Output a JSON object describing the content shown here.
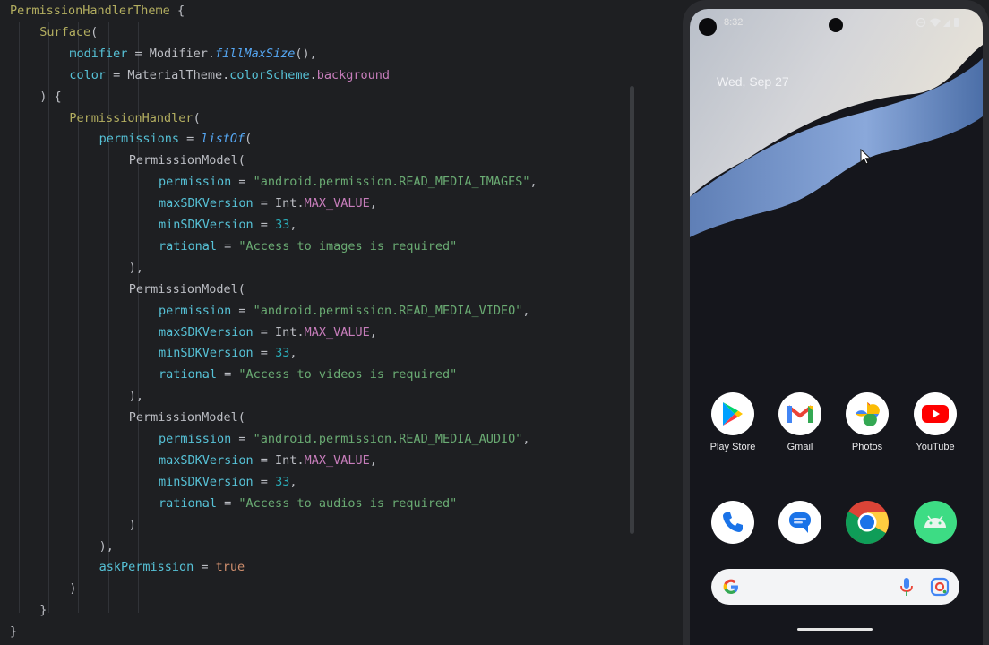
{
  "editor": {
    "lines": [
      {
        "indent": 0,
        "tokens": [
          [
            "PermissionHandlerTheme",
            "t-call"
          ],
          [
            " {",
            "t-plain"
          ]
        ]
      },
      {
        "indent": 1,
        "tokens": [
          [
            "Surface",
            "t-call"
          ],
          [
            "(",
            "t-plain"
          ]
        ]
      },
      {
        "indent": 2,
        "tokens": [
          [
            "modifier",
            "t-param"
          ],
          [
            " = Modifier.",
            "t-plain"
          ],
          [
            "fillMaxSize",
            "t-fn"
          ],
          [
            "(),",
            "t-plain"
          ]
        ]
      },
      {
        "indent": 2,
        "tokens": [
          [
            "color",
            "t-param"
          ],
          [
            " = MaterialTheme.",
            "t-plain"
          ],
          [
            "colorScheme",
            "t-param"
          ],
          [
            ".",
            "t-plain"
          ],
          [
            "background",
            "t-const"
          ]
        ]
      },
      {
        "indent": 1,
        "tokens": [
          [
            ") {",
            "t-plain"
          ]
        ]
      },
      {
        "indent": 2,
        "tokens": [
          [
            "PermissionHandler",
            "t-call"
          ],
          [
            "(",
            "t-plain"
          ]
        ]
      },
      {
        "indent": 3,
        "tokens": [
          [
            "permissions",
            "t-param"
          ],
          [
            " = ",
            "t-plain"
          ],
          [
            "listOf",
            "t-fn"
          ],
          [
            "(",
            "t-plain"
          ]
        ]
      },
      {
        "indent": 4,
        "tokens": [
          [
            "PermissionModel(",
            "t-plain"
          ]
        ]
      },
      {
        "indent": 5,
        "tokens": [
          [
            "permission",
            "t-param"
          ],
          [
            " = ",
            "t-plain"
          ],
          [
            "\"android.permission.READ_MEDIA_IMAGES\"",
            "t-str"
          ],
          [
            ",",
            "t-plain"
          ]
        ]
      },
      {
        "indent": 5,
        "tokens": [
          [
            "maxSDKVersion",
            "t-param"
          ],
          [
            " = Int.",
            "t-plain"
          ],
          [
            "MAX_VALUE",
            "t-const"
          ],
          [
            ",",
            "t-plain"
          ]
        ]
      },
      {
        "indent": 5,
        "tokens": [
          [
            "minSDKVersion",
            "t-param"
          ],
          [
            " = ",
            "t-plain"
          ],
          [
            "33",
            "t-num"
          ],
          [
            ",",
            "t-plain"
          ]
        ]
      },
      {
        "indent": 5,
        "tokens": [
          [
            "rational",
            "t-param"
          ],
          [
            " = ",
            "t-plain"
          ],
          [
            "\"Access to images is required\"",
            "t-str"
          ]
        ]
      },
      {
        "indent": 4,
        "tokens": [
          [
            "),",
            "t-plain"
          ]
        ]
      },
      {
        "indent": 4,
        "tokens": [
          [
            "PermissionModel(",
            "t-plain"
          ]
        ]
      },
      {
        "indent": 5,
        "tokens": [
          [
            "permission",
            "t-param"
          ],
          [
            " = ",
            "t-plain"
          ],
          [
            "\"android.permission.READ_MEDIA_VIDEO\"",
            "t-str"
          ],
          [
            ",",
            "t-plain"
          ]
        ]
      },
      {
        "indent": 5,
        "tokens": [
          [
            "maxSDKVersion",
            "t-param"
          ],
          [
            " = Int.",
            "t-plain"
          ],
          [
            "MAX_VALUE",
            "t-const"
          ],
          [
            ",",
            "t-plain"
          ]
        ]
      },
      {
        "indent": 5,
        "tokens": [
          [
            "minSDKVersion",
            "t-param"
          ],
          [
            " = ",
            "t-plain"
          ],
          [
            "33",
            "t-num"
          ],
          [
            ",",
            "t-plain"
          ]
        ]
      },
      {
        "indent": 5,
        "tokens": [
          [
            "rational",
            "t-param"
          ],
          [
            " = ",
            "t-plain"
          ],
          [
            "\"Access to videos is required\"",
            "t-str"
          ]
        ]
      },
      {
        "indent": 4,
        "tokens": [
          [
            "),",
            "t-plain"
          ]
        ]
      },
      {
        "indent": 4,
        "tokens": [
          [
            "PermissionModel(",
            "t-plain"
          ]
        ]
      },
      {
        "indent": 5,
        "tokens": [
          [
            "permission",
            "t-param"
          ],
          [
            " = ",
            "t-plain"
          ],
          [
            "\"android.permission.READ_MEDIA_AUDIO\"",
            "t-str"
          ],
          [
            ",",
            "t-plain"
          ]
        ]
      },
      {
        "indent": 5,
        "tokens": [
          [
            "maxSDKVersion",
            "t-param"
          ],
          [
            " = Int.",
            "t-plain"
          ],
          [
            "MAX_VALUE",
            "t-const"
          ],
          [
            ",",
            "t-plain"
          ]
        ]
      },
      {
        "indent": 5,
        "tokens": [
          [
            "minSDKVersion",
            "t-param"
          ],
          [
            " = ",
            "t-plain"
          ],
          [
            "33",
            "t-num"
          ],
          [
            ",",
            "t-plain"
          ]
        ]
      },
      {
        "indent": 5,
        "tokens": [
          [
            "rational",
            "t-param"
          ],
          [
            " = ",
            "t-plain"
          ],
          [
            "\"Access to audios is required\"",
            "t-str"
          ]
        ]
      },
      {
        "indent": 4,
        "tokens": [
          [
            ")",
            "t-plain"
          ]
        ]
      },
      {
        "indent": 3,
        "tokens": [
          [
            "),",
            "t-plain"
          ]
        ]
      },
      {
        "indent": 3,
        "tokens": [
          [
            "askPermission",
            "t-param"
          ],
          [
            " = ",
            "t-plain"
          ],
          [
            "true",
            "t-kw"
          ]
        ]
      },
      {
        "indent": 2,
        "tokens": [
          [
            ")",
            "t-plain"
          ]
        ]
      },
      {
        "indent": 1,
        "tokens": [
          [
            "}",
            "t-plain"
          ]
        ]
      },
      {
        "indent": 0,
        "tokens": [
          [
            "}",
            "t-plain"
          ]
        ]
      }
    ]
  },
  "phone": {
    "status_time": "8:32",
    "date": "Wed, Sep 27",
    "apps_row1": [
      {
        "label": "Play Store",
        "icon": "play-store-icon"
      },
      {
        "label": "Gmail",
        "icon": "gmail-icon"
      },
      {
        "label": "Photos",
        "icon": "photos-icon"
      },
      {
        "label": "YouTube",
        "icon": "youtube-icon"
      }
    ],
    "apps_row2": [
      {
        "label": "",
        "icon": "phone-icon"
      },
      {
        "label": "",
        "icon": "messages-icon"
      },
      {
        "label": "",
        "icon": "chrome-icon"
      },
      {
        "label": "",
        "icon": "android-icon"
      }
    ]
  }
}
